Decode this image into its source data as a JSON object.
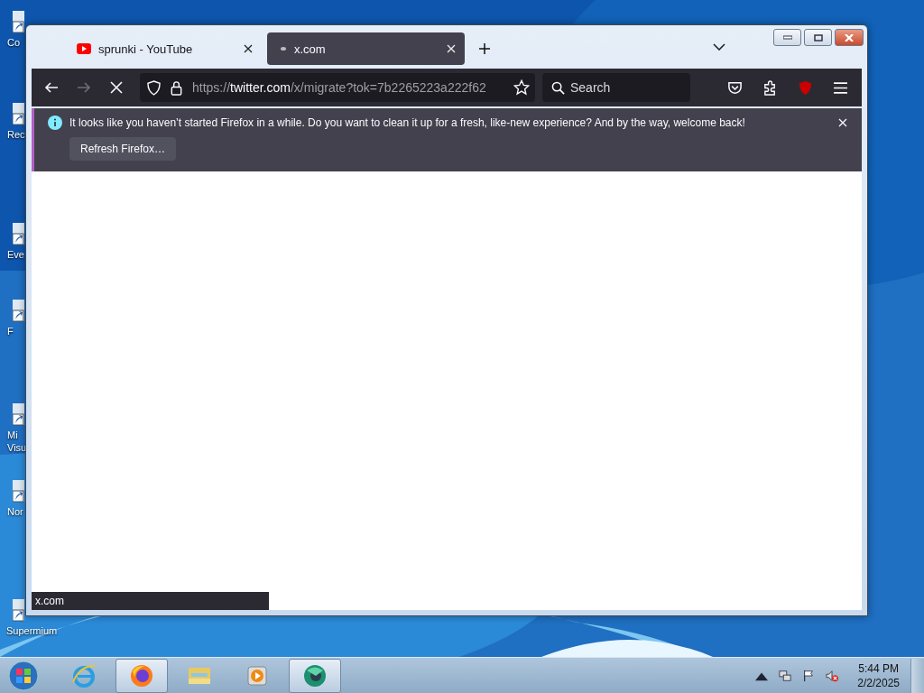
{
  "desktop": {
    "icons": [
      {
        "lines": [
          "Co"
        ]
      },
      {
        "lines": [
          "Rec"
        ]
      },
      {
        "lines": [
          "Eve"
        ]
      },
      {
        "lines": [
          "F"
        ]
      },
      {
        "lines": [
          "Mi",
          "Visu"
        ]
      },
      {
        "lines": [
          "Nor"
        ]
      },
      {
        "lines": [
          "Supermium"
        ]
      }
    ]
  },
  "window": {
    "tabs": [
      {
        "title": "sprunki - YouTube",
        "kind": "youtube",
        "selected": false
      },
      {
        "title": "x.com",
        "kind": "loading",
        "selected": true
      }
    ],
    "toolbar": {
      "back_disabled": false,
      "forward_disabled": true,
      "loading": true,
      "url": {
        "scheme": "https://",
        "host": "twitter.com",
        "rest": "/x/migrate?tok=7b2265223a222f62"
      },
      "search": {
        "placeholder": "Search"
      }
    },
    "notification": {
      "message": "It looks like you haven’t started Firefox in a while. Do you want to clean it up for a fresh, like-new experience? And by the way, welcome back!",
      "button": "Refresh Firefox…"
    },
    "status": "x.com"
  },
  "taskbar": {
    "apps": [
      {
        "kind": "ie",
        "running": false
      },
      {
        "kind": "firefox",
        "running": true
      },
      {
        "kind": "explorer",
        "running": false
      },
      {
        "kind": "media",
        "running": false
      },
      {
        "kind": "browser",
        "running": true
      }
    ],
    "clock": {
      "time": "5:44 PM",
      "date": "2/2/2025"
    }
  }
}
